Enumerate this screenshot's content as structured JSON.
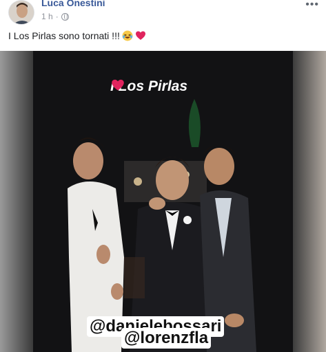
{
  "post": {
    "author": "Luca Onestini",
    "time": "1 h",
    "privacy_icon": "globe-icon",
    "more_icon": "more-horizontal-icon",
    "text": "I Los Pirlas sono tornati !!!",
    "emojis": [
      "laughing-tears-emoji",
      "heart-emoji"
    ]
  },
  "media": {
    "story_title": "I Los Pirlas",
    "title_icon": "heart-emoji",
    "mentions": [
      "@danielebossari",
      "@lorenzfla"
    ]
  },
  "colors": {
    "author_link": "#385898",
    "meta_text": "#90949c",
    "heart": "#e0245e",
    "media_bg": "#111111"
  }
}
